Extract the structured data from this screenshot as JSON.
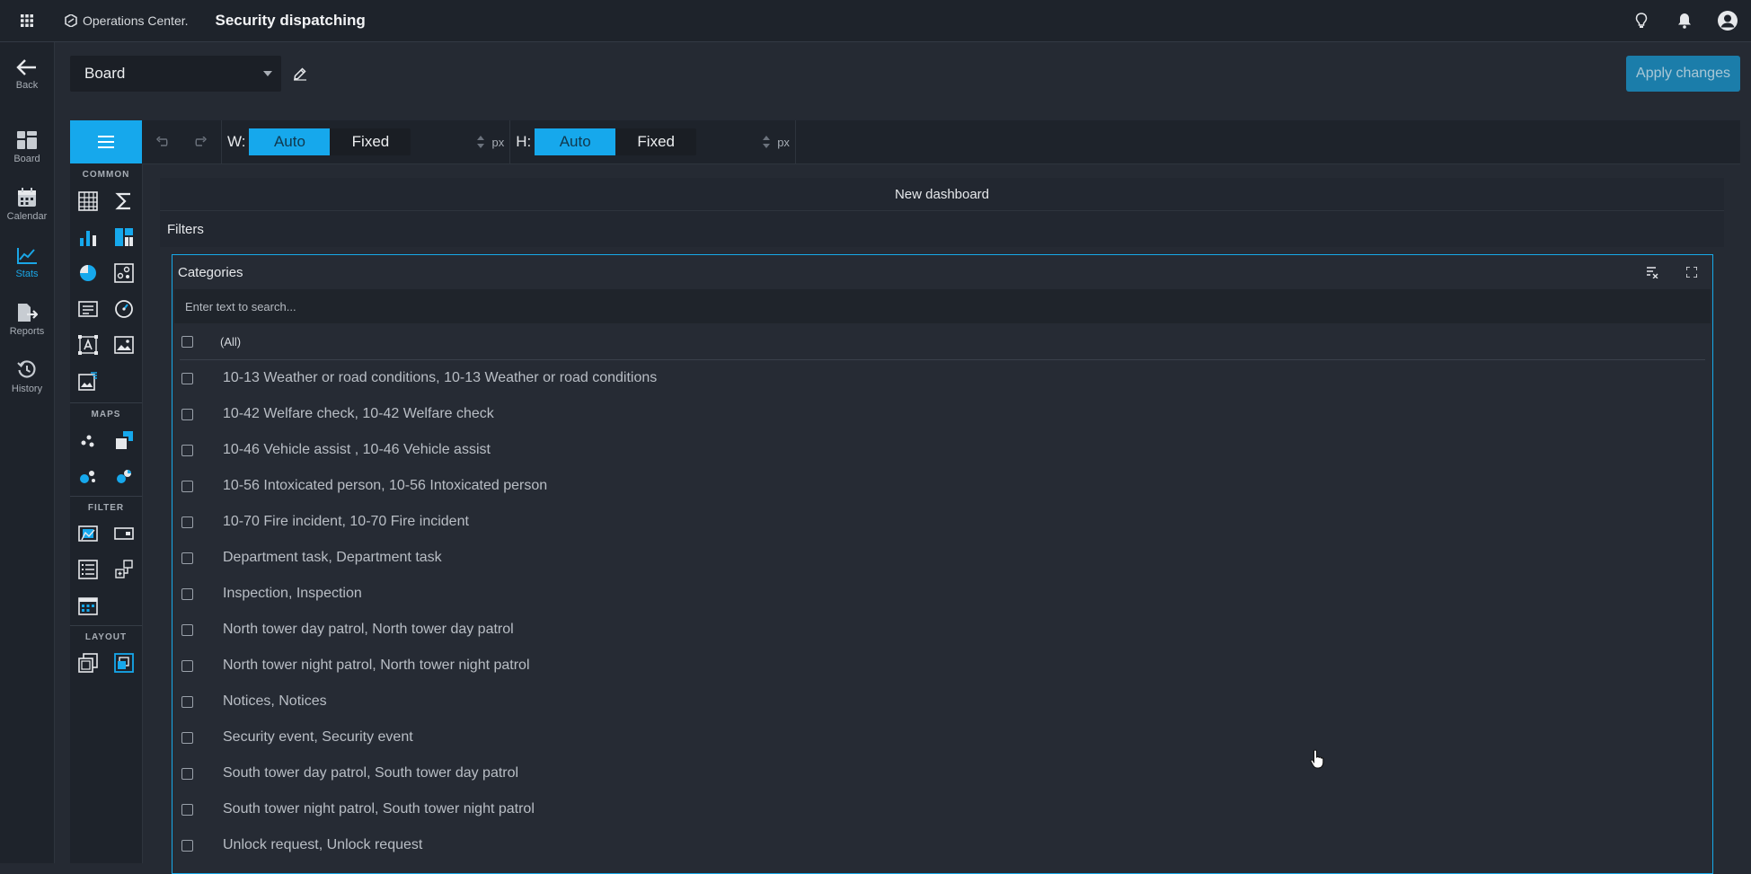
{
  "topbar": {
    "brand": "Operations Center.",
    "title": "Security dispatching"
  },
  "nav": {
    "items": [
      {
        "label": "Back",
        "icon": "arrow-left-icon"
      },
      {
        "label": "Board",
        "icon": "board-icon"
      },
      {
        "label": "Calendar",
        "icon": "calendar-icon"
      },
      {
        "label": "Stats",
        "icon": "stats-icon",
        "active": true
      },
      {
        "label": "Reports",
        "icon": "reports-icon"
      },
      {
        "label": "History",
        "icon": "history-icon"
      }
    ]
  },
  "board": {
    "selected": "Board",
    "apply_label": "Apply changes"
  },
  "toolbox": {
    "sections": [
      "COMMON",
      "MAPS",
      "FILTER",
      "LAYOUT"
    ]
  },
  "sizebar": {
    "width_label": "W:",
    "height_label": "H:",
    "auto": "Auto",
    "fixed": "Fixed",
    "unit": "px"
  },
  "dashboard": {
    "title": "New dashboard",
    "filters_label": "Filters",
    "card_title": "Categories",
    "search_placeholder": "Enter text to search...",
    "all_label": "(All)",
    "items": [
      "10-13 Weather or road conditions, 10-13 Weather or road conditions",
      "10-42 Welfare check, 10-42 Welfare check",
      "10-46 Vehicle assist , 10-46 Vehicle assist",
      "10-56 Intoxicated person, 10-56 Intoxicated person",
      "10-70 Fire incident, 10-70 Fire incident",
      "Department task, Department task",
      "Inspection, Inspection",
      "North tower day patrol, North tower day patrol",
      "North tower night patrol, North tower night patrol",
      "Notices, Notices",
      "Security event, Security event",
      "South tower day patrol, South tower day patrol",
      "South tower night patrol, South tower night patrol",
      "Unlock request, Unlock request"
    ]
  },
  "colors": {
    "accent": "#16a8ec",
    "background": "#252a33",
    "panel": "#1e232b"
  }
}
